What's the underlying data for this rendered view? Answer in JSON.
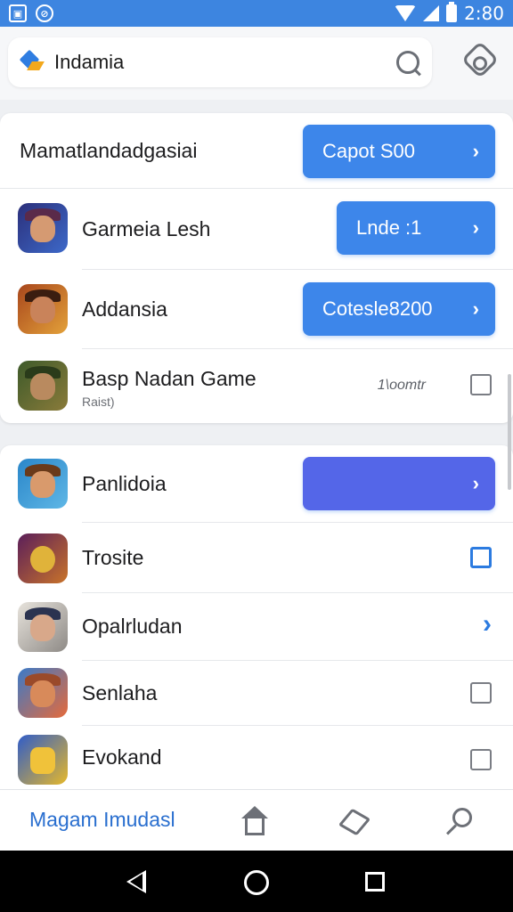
{
  "status_bar": {
    "time": "2:80"
  },
  "header": {
    "title": "Indamia"
  },
  "section1": {
    "top_row": {
      "label": "Mamatlandadgasiai",
      "button": "Capot S00"
    },
    "items": [
      {
        "label": "Garmeia Lesh",
        "button": "Lnde :1"
      },
      {
        "label": "Addansia",
        "button": "Cotesle8200"
      },
      {
        "label": "Basp Nadan Game",
        "sublabel": "Raist)",
        "meta": "1\\oomtr"
      }
    ]
  },
  "section2": {
    "items": [
      {
        "label": "Panlidoia"
      },
      {
        "label": "Trosite"
      },
      {
        "label": "Opalrludan"
      },
      {
        "label": "Senlaha"
      },
      {
        "label": "Evokand"
      }
    ]
  },
  "bottom_bar": {
    "label": "Magam Imudasl"
  },
  "icons": {
    "header": [
      "logo-icon",
      "search-icon",
      "gear-icon"
    ],
    "bottom": [
      "home-icon",
      "box-icon",
      "search-icon"
    ],
    "nav": [
      "back-icon",
      "home-circle-icon",
      "recents-icon"
    ]
  },
  "colors": {
    "accent": "#3d86ea",
    "purple_button": "#5466e8",
    "statusbar": "#3d85e0"
  }
}
